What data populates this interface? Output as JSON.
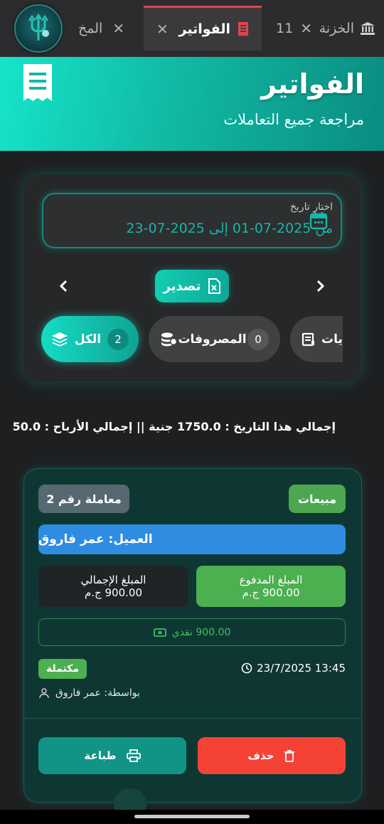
{
  "tabs": [
    {
      "label": "المخ"
    },
    {
      "label": "الفواتير",
      "active": true
    },
    {
      "label": "الخزنة"
    },
    {
      "label": "11"
    }
  ],
  "header": {
    "title": "الفواتير",
    "subtitle": "مراجعة جميع التعاملات",
    "icon": "receipt-icon"
  },
  "date_filter": {
    "label": "اختار تاريخ",
    "range": "من 2025-07-01 إلى  2025-07-23",
    "icon": "calendar-icon"
  },
  "export": {
    "label": "تصدير",
    "icon": "excel-file-icon"
  },
  "filters": [
    {
      "label": "الكل",
      "count": "2",
      "active": true,
      "icon": "stack-icon"
    },
    {
      "label": "المصروفات",
      "count": "0",
      "icon": "coins-icon"
    },
    {
      "label": "يات",
      "icon": "receipt-small-icon"
    }
  ],
  "totals": "إجمالي هذا التاريخ : 1750.0 جنية  ||  إجمالي الأرباح  : 50.0",
  "transaction": {
    "type": "مبيعات",
    "number": "معاملة رقم 2",
    "client": "العميل: عمر فاروق",
    "paid_label": "المبلغ المدفوع",
    "paid_value": "900.00 ج.م",
    "total_label": "المبلغ الإجمالي",
    "total_value": "900.00 ج.م",
    "payment": "900.00 نقدي",
    "status": "مكتملة",
    "datetime": "23/7/2025 13:45",
    "by": "بواسطة: عمر فاروق",
    "print_label": "طباعة",
    "delete_label": "حذف"
  },
  "colors": {
    "accent": "#12CDB2",
    "sales_badge": "#4CA750",
    "client_bar": "#2E8DE0",
    "delete": "#F44336",
    "print": "#119486",
    "tab_active_border": "#E4434A"
  }
}
